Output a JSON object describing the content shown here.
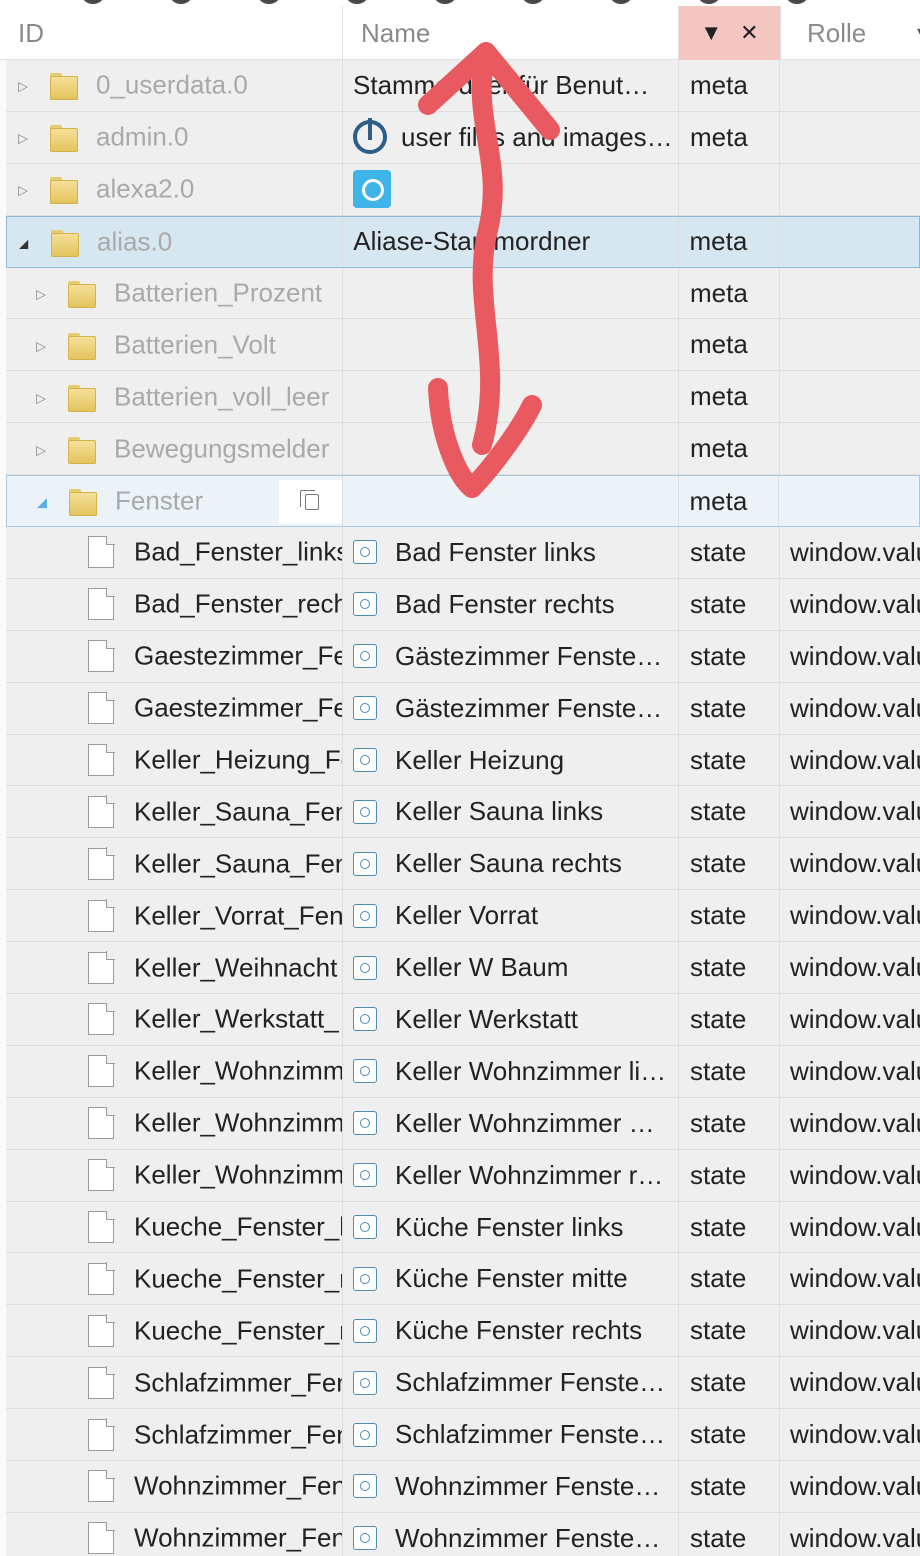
{
  "header": {
    "id_label": "ID",
    "name_label": "Name",
    "type_sort_icon": "▼",
    "type_clear_icon": "✕",
    "role_label": "Rolle"
  },
  "rows": [
    {
      "kind": "folder",
      "level": 0,
      "expanded": false,
      "id": "0_userdata.0",
      "name": "Stammordner für Benut…",
      "type": "meta",
      "role": ""
    },
    {
      "kind": "folder",
      "level": 0,
      "expanded": false,
      "id": "admin.0",
      "name": "user files and images…",
      "name_icon": "power-icon",
      "type": "meta",
      "role": ""
    },
    {
      "kind": "folder",
      "level": 0,
      "expanded": false,
      "id": "alexa2.0",
      "name": "",
      "name_icon": "alexa-icon",
      "type": "",
      "role": ""
    },
    {
      "kind": "folder",
      "level": 0,
      "expanded": true,
      "selected": true,
      "id": "alias.0",
      "name": "Aliase-Stammordner",
      "type": "meta",
      "role": ""
    },
    {
      "kind": "folder",
      "level": 1,
      "expanded": false,
      "id": "Batterien_Prozent",
      "name": "",
      "type": "meta",
      "role": ""
    },
    {
      "kind": "folder",
      "level": 1,
      "expanded": false,
      "id": "Batterien_Volt",
      "name": "",
      "type": "meta",
      "role": ""
    },
    {
      "kind": "folder",
      "level": 1,
      "expanded": false,
      "id": "Batterien_voll_leer",
      "name": "",
      "type": "meta",
      "role": ""
    },
    {
      "kind": "folder",
      "level": 1,
      "expanded": false,
      "id": "Bewegungsmelder",
      "name": "",
      "type": "meta",
      "role": ""
    },
    {
      "kind": "folder",
      "level": 1,
      "expanded": true,
      "active": true,
      "id": "Fenster",
      "name": "",
      "type": "meta",
      "role": "",
      "copy_icon": "copy-icon"
    },
    {
      "kind": "state",
      "id": "Bad_Fenster_links",
      "name": "Bad Fenster links",
      "type": "state",
      "role": "window.value"
    },
    {
      "kind": "state",
      "id": "Bad_Fenster_rechts",
      "name": "Bad Fenster rechts",
      "type": "state",
      "role": "window.value"
    },
    {
      "kind": "state",
      "id": "Gaestezimmer_Fenster",
      "name": "Gästezimmer Fenste…",
      "type": "state",
      "role": "window.value"
    },
    {
      "kind": "state",
      "id": "Gaestezimmer_Fenster",
      "name": "Gästezimmer Fenste…",
      "type": "state",
      "role": "window.value"
    },
    {
      "kind": "state",
      "id": "Keller_Heizung_Fenster",
      "name": "Keller Heizung",
      "type": "state",
      "role": "window.value"
    },
    {
      "kind": "state",
      "id": "Keller_Sauna_Fenster",
      "name": "Keller Sauna links",
      "type": "state",
      "role": "window.value"
    },
    {
      "kind": "state",
      "id": "Keller_Sauna_Fenster",
      "name": "Keller Sauna rechts",
      "type": "state",
      "role": "window.value"
    },
    {
      "kind": "state",
      "id": "Keller_Vorrat_Fenster",
      "name": "Keller Vorrat",
      "type": "state",
      "role": "window.value"
    },
    {
      "kind": "state",
      "id": "Keller_Weihnacht",
      "name": "Keller W Baum",
      "type": "state",
      "role": "window.value"
    },
    {
      "kind": "state",
      "id": "Keller_Werkstatt_",
      "name": "Keller Werkstatt",
      "type": "state",
      "role": "window.value"
    },
    {
      "kind": "state",
      "id": "Keller_Wohnzimmer",
      "name": "Keller Wohnzimmer li…",
      "type": "state",
      "role": "window.value"
    },
    {
      "kind": "state",
      "id": "Keller_Wohnzimmer",
      "name": "Keller Wohnzimmer …",
      "type": "state",
      "role": "window.value"
    },
    {
      "kind": "state",
      "id": "Keller_Wohnzimmer",
      "name": "Keller Wohnzimmer r…",
      "type": "state",
      "role": "window.value"
    },
    {
      "kind": "state",
      "id": "Kueche_Fenster_l",
      "name": "Küche Fenster links",
      "type": "state",
      "role": "window.value"
    },
    {
      "kind": "state",
      "id": "Kueche_Fenster_m",
      "name": "Küche Fenster mitte",
      "type": "state",
      "role": "window.value"
    },
    {
      "kind": "state",
      "id": "Kueche_Fenster_r",
      "name": "Küche Fenster rechts",
      "type": "state",
      "role": "window.value"
    },
    {
      "kind": "state",
      "id": "Schlafzimmer_Fenster",
      "name": "Schlafzimmer Fenste…",
      "type": "state",
      "role": "window.value"
    },
    {
      "kind": "state",
      "id": "Schlafzimmer_Fenster",
      "name": "Schlafzimmer Fenste…",
      "type": "state",
      "role": "window.value"
    },
    {
      "kind": "state",
      "id": "Wohnzimmer_Fenster",
      "name": "Wohnzimmer Fenste…",
      "type": "state",
      "role": "window.value"
    },
    {
      "kind": "state",
      "id": "Wohnzimmer_Fenster",
      "name": "Wohnzimmer Fenste…",
      "type": "state",
      "role": "window.value"
    }
  ],
  "colors": {
    "annotation_arrow": "#e85a5f",
    "header_type_bg": "#f3c6c1",
    "selected_row_bg": "#d6e7f2"
  },
  "annotation": {
    "shape": "double-headed-arrow"
  }
}
